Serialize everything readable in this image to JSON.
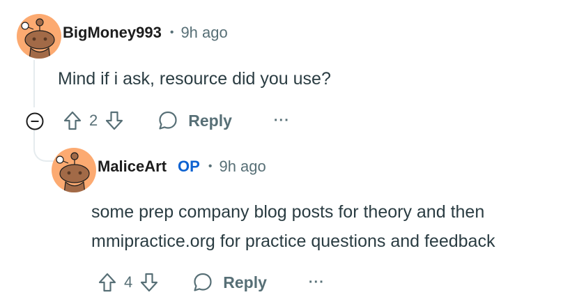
{
  "comments": [
    {
      "username": "BigMoney993",
      "timestamp": "9h ago",
      "body": [
        "Mind if i ask, resource did you use?"
      ],
      "upvotes": "2",
      "reply_label": "Reply",
      "more_label": "···",
      "avatar_color": "#fcaa71"
    },
    {
      "username": "MaliceArt",
      "op_badge": "OP",
      "timestamp": "9h ago",
      "body": [
        "some prep company blog posts for theory and then",
        "mmipractice.org for practice questions and feedback"
      ],
      "upvotes": "4",
      "reply_label": "Reply",
      "more_label": "···",
      "avatar_color": "#fcaa71"
    }
  ],
  "meta_separator": "•",
  "colors": {
    "text": "#1c1c1c",
    "secondary": "#576f76",
    "op_blue": "#0f63d1",
    "thread_line": "#e5ebee"
  },
  "icons": [
    "snoo-avatar-icon",
    "collapse-thread-icon",
    "upvote-arrow-icon",
    "downvote-arrow-icon",
    "reply-bubble-icon"
  ]
}
